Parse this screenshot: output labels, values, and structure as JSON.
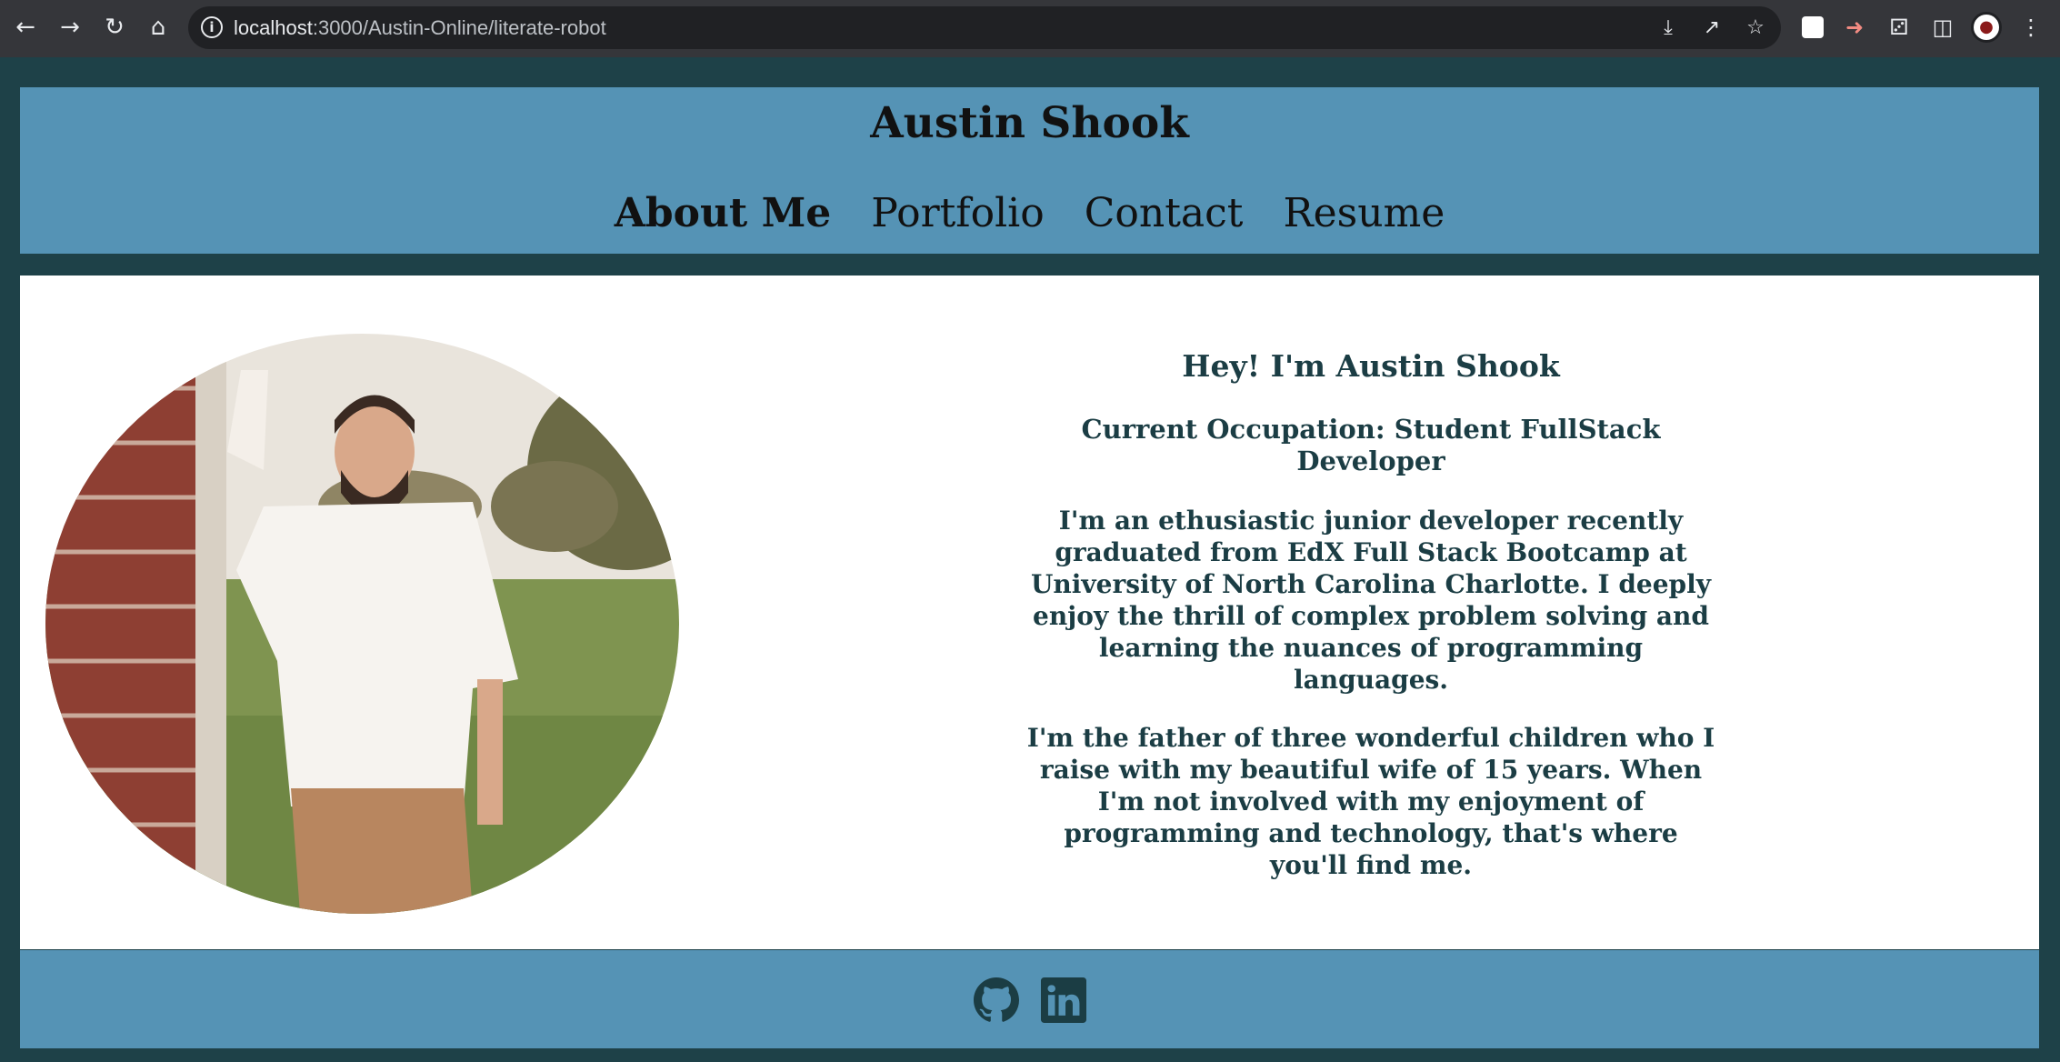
{
  "browser": {
    "url_host": "localhost",
    "url_rest": ":3000/Austin-Online/literate-robot",
    "icons": [
      "back-icon",
      "forward-icon",
      "reload-icon",
      "home-icon",
      "site-info-icon",
      "install-icon",
      "share-icon",
      "bookmark-star-icon",
      "extension-square-icon",
      "extension-arrow-icon",
      "extensions-puzzle-icon",
      "side-panel-icon",
      "profile-avatar-icon",
      "menu-kebab-icon"
    ]
  },
  "header": {
    "title": "Austin Shook",
    "nav": [
      {
        "label": "About Me",
        "active": true
      },
      {
        "label": "Portfolio",
        "active": false
      },
      {
        "label": "Contact",
        "active": false
      },
      {
        "label": "Resume",
        "active": false
      }
    ]
  },
  "about": {
    "heading": "Hey! I'm Austin Shook",
    "occupation": "Current Occupation: Student FullStack Developer",
    "paragraph1": "I'm an ethusiastic junior developer recently graduated from EdX Full Stack Bootcamp at University of North Carolina Charlotte. I deeply enjoy the thrill of complex problem solving and learning the nuances of programming languages.",
    "paragraph2": "I'm the father of three wonderful children who I raise with my beautiful wife of 15 years. When I'm not involved with my enjoyment of programming and technology, that's where you'll find me."
  },
  "footer": {
    "icons": [
      "github-icon",
      "linkedin-icon"
    ]
  },
  "colors": {
    "page_background": "#1e4148",
    "header_footer": "#5593b5",
    "content_background": "#ffffff",
    "text_dark_teal": "#1b3d44"
  }
}
